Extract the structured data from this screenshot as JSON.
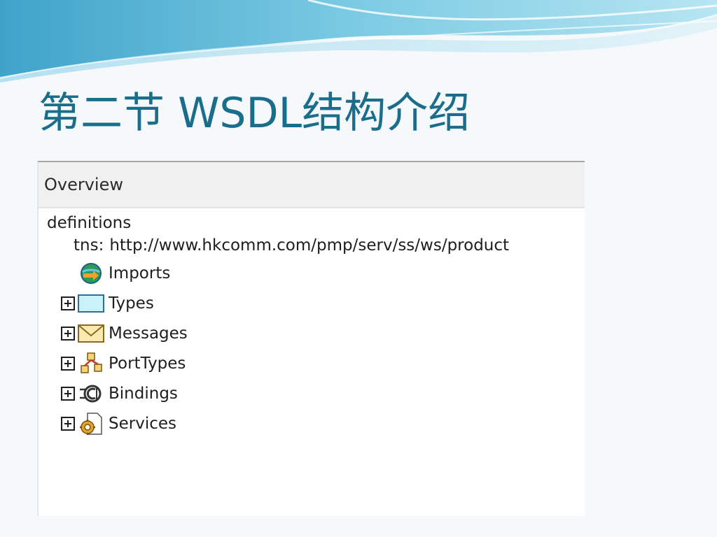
{
  "slide": {
    "title": "第二节 WSDL结构介绍"
  },
  "panel": {
    "header_label": "Overview"
  },
  "tree": {
    "root_label": "definitions",
    "tns_label": "tns:",
    "tns_value": "http://www.hkcomm.com/pmp/serv/ss/ws/product",
    "nodes": [
      {
        "label": "Imports",
        "icon": "imports-globe-icon",
        "expandable": false
      },
      {
        "label": "Types",
        "icon": "types-box-icon",
        "expandable": true
      },
      {
        "label": "Messages",
        "icon": "messages-envelope-icon",
        "expandable": true
      },
      {
        "label": "PortTypes",
        "icon": "porttypes-icon",
        "expandable": true
      },
      {
        "label": "Bindings",
        "icon": "bindings-icon",
        "expandable": true
      },
      {
        "label": "Services",
        "icon": "services-gear-icon",
        "expandable": true
      }
    ]
  },
  "colors": {
    "title": "#1a6e8c",
    "header_bg": "#f0f0f0",
    "accent_wave": "#5fb8d6"
  }
}
